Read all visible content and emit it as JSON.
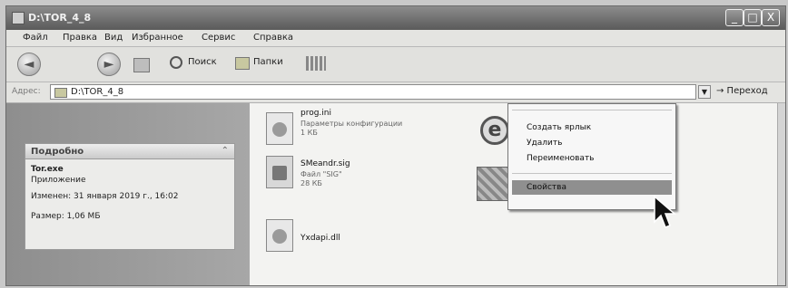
{
  "window": {
    "title": "D:\\TOR_4_8"
  },
  "titlebar": {
    "minimize": "_",
    "maximize": "□",
    "close": "X"
  },
  "menu": {
    "items": [
      "Файл",
      "Правка",
      "Вид",
      "Избранное",
      "Сервис",
      "Справка"
    ]
  },
  "toolbar": {
    "back_glyph": "◄",
    "forward_glyph": "►",
    "search": "Поиск",
    "folders": "Папки"
  },
  "address": {
    "label": "Адрес:",
    "value": "D:\\TOR_4_8",
    "dropdown_glyph": "▼",
    "go": "→ Переход"
  },
  "details_panel": {
    "header": "Подробно",
    "collapse_glyph": "⌃",
    "name": "Tor.exe",
    "type": "Приложение",
    "modified": "Изменен: 31 января 2019 г., 16:02",
    "size": "Размер: 1,06 МБ"
  },
  "files": [
    {
      "name": "prog.ini",
      "desc1": "Параметры конфигурации",
      "desc2": "1 КБ",
      "icon": "config-file-icon"
    },
    {
      "name": "SMeandr.sig",
      "desc1": "Файл \"SIG\"",
      "desc2": "28 КБ",
      "icon": "document-file-icon"
    },
    {
      "name": "Yxdapi.dll",
      "icon": "dll-file-icon"
    }
  ],
  "context_menu": {
    "items": [
      "Создать ярлык",
      "Удалить",
      "Переименовать",
      "Свойства"
    ],
    "selected": "Свойства"
  }
}
